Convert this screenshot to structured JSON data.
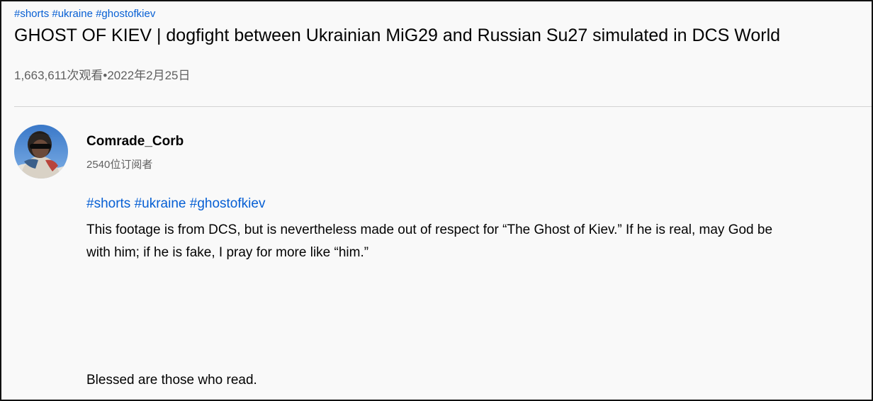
{
  "video": {
    "hashtags": [
      "#shorts",
      "#ukraine",
      "#ghostofkiev"
    ],
    "title": "GHOST OF KIEV | dogfight between Ukrainian MiG29 and Russian Su27 simulated in DCS World",
    "views": "1,663,611次观看",
    "separator": "•",
    "date": "2022年2月25日"
  },
  "channel": {
    "name": "Comrade_Corb",
    "subscribers": "2540位订阅者",
    "avatar_icon": "user-avatar-icon"
  },
  "description": {
    "hashtags": [
      "#shorts",
      "#ukraine",
      "#ghostofkiev"
    ],
    "body": "This footage is from DCS, but is nevertheless made out of respect for “The Ghost of Kiev.” If he is real, may God be with him; if he is fake, I pray for more like “him.”",
    "closing": "Blessed are those who read."
  },
  "colors": {
    "link": "#065fd4",
    "secondary_text": "#606060",
    "background": "#f9f9f9"
  }
}
